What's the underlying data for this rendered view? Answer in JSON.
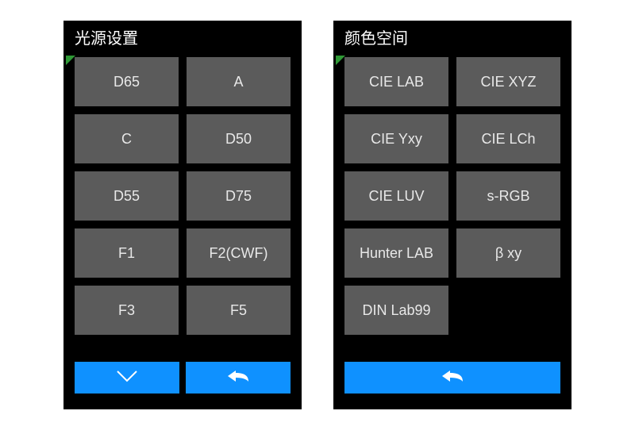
{
  "colors": {
    "accent": "#0f91ff",
    "corner": "#2f9936",
    "tile": "#5b5b5b",
    "panel_bg": "#000000"
  },
  "panels": {
    "left": {
      "title": "光源设置",
      "options": [
        "D65",
        "A",
        "C",
        "D50",
        "D55",
        "D75",
        "F1",
        "F2(CWF)",
        "F3",
        "F5"
      ],
      "bottomButtons": [
        {
          "icon": "chevron-down-icon"
        },
        {
          "icon": "back-icon"
        }
      ]
    },
    "right": {
      "title": "颜色空间",
      "options": [
        "CIE LAB",
        "CIE XYZ",
        "CIE Yxy",
        "CIE LCh",
        "CIE LUV",
        "s-RGB",
        "Hunter LAB",
        "β xy",
        "DIN Lab99"
      ],
      "bottomButtons": [
        {
          "icon": "back-icon"
        }
      ]
    }
  }
}
